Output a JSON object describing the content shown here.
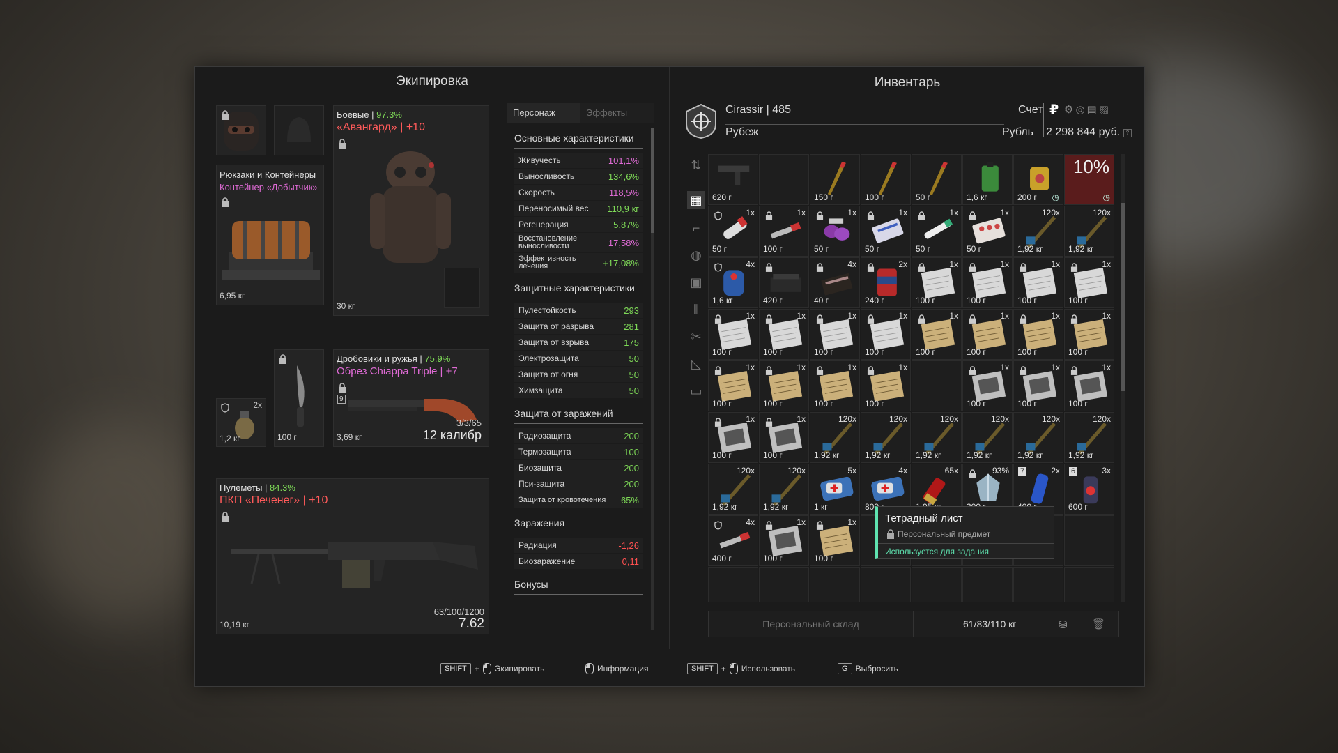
{
  "equipment": {
    "title": "Экипировка",
    "armor": {
      "category": "Боевые",
      "durability": "97.3%",
      "name": "«Авангард» | +10",
      "weight": "30 кг"
    },
    "backpack": {
      "category": "Рюкзаки и Контейнеры",
      "name": "Контейнер «Добытчик»",
      "weight": "6,95 кг"
    },
    "grenade": {
      "count": "2x",
      "weight": "1,2 кг"
    },
    "knife": {
      "weight": "100 г"
    },
    "shotgun": {
      "category": "Дробовики и ружья",
      "durability": "75.9%",
      "name": "Обрез Chiappa Triple | +7",
      "weight": "3,69 кг",
      "ammo": "3/3/65",
      "caliber": "12 калибр",
      "slot_key": "9"
    },
    "machinegun": {
      "category": "Пулеметы",
      "durability": "84.3%",
      "name": "ПКП «Печенег» | +10",
      "weight": "10,19 кг",
      "ammo": "63/100/1200",
      "caliber": "7.62"
    }
  },
  "stats": {
    "tabs": [
      "Персонаж",
      "Эффекты"
    ],
    "main": {
      "title": "Основные характеристики",
      "rows": [
        {
          "label": "Живучесть",
          "value": "101,1%",
          "color": "pink"
        },
        {
          "label": "Выносливость",
          "value": "134,6%",
          "color": "green"
        },
        {
          "label": "Скорость",
          "value": "118,5%",
          "color": "pink"
        },
        {
          "label": "Переносимый вес",
          "value": "110,9 кг",
          "color": "green"
        },
        {
          "label": "Регенерация",
          "value": "5,87%",
          "color": "green"
        },
        {
          "label": "Восстановление выносливости",
          "value": "17,58%",
          "color": "pink"
        },
        {
          "label": "Эффективность лечения",
          "value": "+17,08%",
          "color": "green"
        }
      ]
    },
    "protection": {
      "title": "Защитные характеристики",
      "rows": [
        {
          "label": "Пулестойкость",
          "value": "293",
          "color": "green"
        },
        {
          "label": "Защита от разрыва",
          "value": "281",
          "color": "green"
        },
        {
          "label": "Защита от взрыва",
          "value": "175",
          "color": "green"
        },
        {
          "label": "Электрозащита",
          "value": "50",
          "color": "green"
        },
        {
          "label": "Защита от огня",
          "value": "50",
          "color": "green"
        },
        {
          "label": "Химзащита",
          "value": "50",
          "color": "green"
        }
      ]
    },
    "contamination_protection": {
      "title": "Защита от заражений",
      "rows": [
        {
          "label": "Радиозащита",
          "value": "200",
          "color": "green"
        },
        {
          "label": "Термозащита",
          "value": "100",
          "color": "green"
        },
        {
          "label": "Биозащита",
          "value": "200",
          "color": "green"
        },
        {
          "label": "Пси-защита",
          "value": "200",
          "color": "green"
        },
        {
          "label": "Защита от кровотечения",
          "value": "65%",
          "color": "green"
        }
      ]
    },
    "contamination": {
      "title": "Заражения",
      "rows": [
        {
          "label": "Радиация",
          "value": "-1,26",
          "color": "red"
        },
        {
          "label": "Биозаражение",
          "value": "0,11",
          "color": "red"
        }
      ]
    },
    "bonuses": {
      "title": "Бонусы"
    }
  },
  "inventory": {
    "title": "Инвентарь",
    "player": "Cirassir | 485",
    "location": "Рубеж",
    "account_label": "Счет",
    "currency_label": "Рубль",
    "balance": "2 298 844 руб.",
    "storage_label": "Персональный склад",
    "weight": "61/83/110 кг",
    "tooltip": {
      "title": "Тетрадный лист",
      "subtitle": "Персональный предмет",
      "note": "Используется для задания"
    },
    "rows": [
      [
        {
          "w": "620 г",
          "t": "gun"
        },
        {
          "w": "",
          "t": "empty"
        },
        {
          "w": "150 г",
          "t": "pen"
        },
        {
          "w": "100 г",
          "t": "pen"
        },
        {
          "w": "50 г",
          "t": "pen"
        },
        {
          "w": "1,6 кг",
          "t": "bottle"
        },
        {
          "w": "200 г",
          "t": "bag",
          "clock": true
        },
        {
          "w": "",
          "t": "pct",
          "pct": "10%",
          "clock": true
        }
      ],
      [
        {
          "w": "50 г",
          "q": "1x",
          "t": "tube",
          "shield": true
        },
        {
          "w": "100 г",
          "q": "1x",
          "t": "syringe",
          "lock": true
        },
        {
          "w": "50 г",
          "q": "1x",
          "t": "pills",
          "lock": true
        },
        {
          "w": "50 г",
          "q": "1x",
          "t": "blister",
          "lock": true
        },
        {
          "w": "50 г",
          "q": "1x",
          "t": "tube2",
          "lock": true
        },
        {
          "w": "50 г",
          "q": "1x",
          "t": "blister2",
          "lock": true
        },
        {
          "w": "1,92 кг",
          "q": "120x",
          "t": "ammo"
        },
        {
          "w": "1,92 кг",
          "q": "120x",
          "t": "ammo"
        }
      ],
      [
        {
          "w": "1,6 кг",
          "q": "4x",
          "t": "blueflask",
          "shield": true
        },
        {
          "w": "420 г",
          "q": "",
          "t": "box",
          "lock": true
        },
        {
          "w": "40 г",
          "q": "4x",
          "t": "book",
          "lock": true
        },
        {
          "w": "240 г",
          "q": "2x",
          "t": "jar",
          "lock": true
        },
        {
          "w": "100 г",
          "q": "1x",
          "t": "paper",
          "lock": true
        },
        {
          "w": "100 г",
          "q": "1x",
          "t": "paper",
          "lock": true
        },
        {
          "w": "100 г",
          "q": "1x",
          "t": "paper",
          "lock": true
        },
        {
          "w": "100 г",
          "q": "1x",
          "t": "paper",
          "lock": true
        }
      ],
      [
        {
          "w": "100 г",
          "q": "1x",
          "t": "paper",
          "lock": true
        },
        {
          "w": "100 г",
          "q": "1x",
          "t": "paper",
          "lock": true
        },
        {
          "w": "100 г",
          "q": "1x",
          "t": "paper",
          "lock": true
        },
        {
          "w": "100 г",
          "q": "1x",
          "t": "paper",
          "lock": true
        },
        {
          "w": "100 г",
          "q": "1x",
          "t": "yellowpaper",
          "lock": true
        },
        {
          "w": "100 г",
          "q": "1x",
          "t": "yellowpaper",
          "lock": true
        },
        {
          "w": "100 г",
          "q": "1x",
          "t": "yellowpaper",
          "lock": true
        },
        {
          "w": "100 г",
          "q": "1x",
          "t": "yellowpaper",
          "lock": true
        }
      ],
      [
        {
          "w": "100 г",
          "q": "1x",
          "t": "yellowpaper",
          "lock": true
        },
        {
          "w": "100 г",
          "q": "1x",
          "t": "yellowpaper",
          "lock": true
        },
        {
          "w": "100 г",
          "q": "1x",
          "t": "yellowpaper",
          "lock": true
        },
        {
          "w": "100 г",
          "q": "1x",
          "t": "yellowpaper",
          "lock": true
        },
        {
          "w": "",
          "t": "empty"
        },
        {
          "w": "100 г",
          "q": "1x",
          "t": "map",
          "lock": true
        },
        {
          "w": "100 г",
          "q": "1x",
          "t": "map",
          "lock": true
        },
        {
          "w": "100 г",
          "q": "1x",
          "t": "map",
          "lock": true
        }
      ],
      [
        {
          "w": "100 г",
          "q": "1x",
          "t": "map",
          "lock": true
        },
        {
          "w": "100 г",
          "q": "1x",
          "t": "map",
          "lock": true
        },
        {
          "w": "1,92 кг",
          "q": "120x",
          "t": "ammo"
        },
        {
          "w": "1,92 кг",
          "q": "120x",
          "t": "ammo"
        },
        {
          "w": "1,92 кг",
          "q": "120x",
          "t": "ammo"
        },
        {
          "w": "1,92 кг",
          "q": "120x",
          "t": "ammo"
        },
        {
          "w": "1,92 кг",
          "q": "120x",
          "t": "ammo"
        },
        {
          "w": "1,92 кг",
          "q": "120x",
          "t": "ammo"
        }
      ],
      [
        {
          "w": "1,92 кг",
          "q": "120x",
          "t": "ammo"
        },
        {
          "w": "1,92 кг",
          "q": "120x",
          "t": "ammo"
        },
        {
          "w": "1 кг",
          "q": "5x",
          "t": "medkit"
        },
        {
          "w": "800 г",
          "q": "4x",
          "t": "medkit"
        },
        {
          "w": "1,95 кг",
          "q": "65x",
          "t": "shell"
        },
        {
          "w": "300 г",
          "q": "93%",
          "t": "crystal",
          "lock": true
        },
        {
          "w": "400 г",
          "q": "2x",
          "t": "blueinj",
          "key": "7"
        },
        {
          "w": "600 г",
          "q": "3x",
          "t": "spray",
          "key": "6"
        }
      ],
      [
        {
          "w": "400 г",
          "q": "4x",
          "t": "syringe",
          "shield": true
        },
        {
          "w": "100 г",
          "q": "1x",
          "t": "map",
          "lock": true
        },
        {
          "w": "100 г",
          "q": "1x",
          "t": "yellowpaper",
          "lock": true
        },
        {
          "w": "",
          "t": "empty"
        },
        {
          "w": "",
          "t": "empty"
        },
        {
          "w": "",
          "t": "empty"
        },
        {
          "w": "",
          "t": "empty"
        },
        {
          "w": "",
          "t": "empty"
        }
      ],
      [
        {
          "w": "",
          "t": "empty"
        },
        {
          "w": "",
          "t": "empty"
        },
        {
          "w": "",
          "t": "empty"
        },
        {
          "w": "",
          "t": "empty"
        },
        {
          "w": "",
          "t": "empty"
        },
        {
          "w": "",
          "t": "empty"
        },
        {
          "w": "",
          "t": "empty"
        },
        {
          "w": "",
          "t": "empty"
        }
      ]
    ]
  },
  "hints": [
    {
      "key": "SHIFT",
      "plus": "+",
      "label": "Экипировать"
    },
    {
      "key": "",
      "label": "Информация"
    },
    {
      "key": "SHIFT",
      "plus": "+",
      "label": "Использовать"
    },
    {
      "key": "G",
      "label": "Выбросить"
    }
  ]
}
